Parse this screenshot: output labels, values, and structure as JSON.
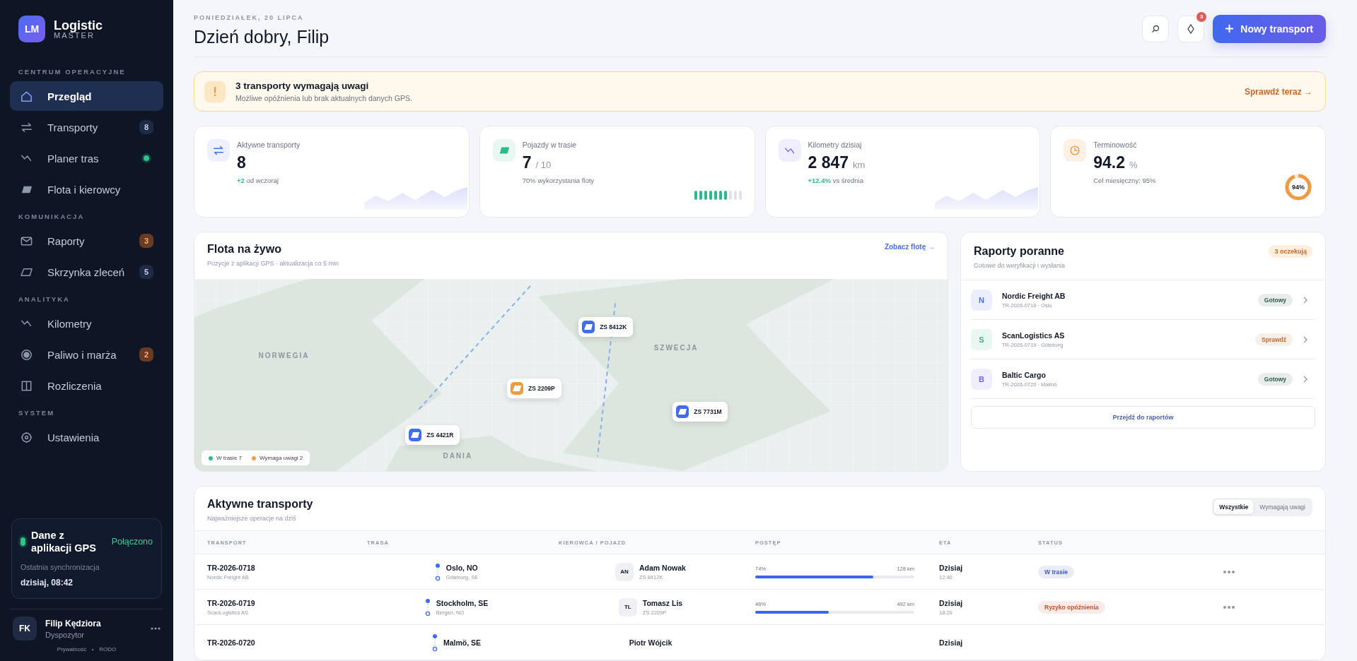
{
  "brand": {
    "initials": "LM",
    "name": "Logistic",
    "sub": "MASTER"
  },
  "sidebar": {
    "sections": [
      {
        "title": "CENTRUM OPERACYJNE",
        "items": [
          {
            "label": "Przegląd",
            "selected": true
          },
          {
            "label": "Transporty",
            "selected": false,
            "badge": {
              "text": "8",
              "color": "#1f2a44"
            }
          },
          {
            "label": "Planer tras",
            "selected": false,
            "color": "#2fc48d"
          },
          {
            "label": "Flota i kierowcy",
            "selected": false
          }
        ]
      },
      {
        "title": "KOMUNIKACJA",
        "items": [
          {
            "label": "Raporty",
            "selected": false,
            "badge": {
              "text": "3",
              "color": "#6b3a22"
            }
          },
          {
            "label": "Skrzynka zleceń",
            "selected": false,
            "badge": {
              "text": "5",
              "color": "#1f2a44"
            }
          }
        ]
      },
      {
        "title": "ANALITYKA",
        "items": [
          {
            "label": "Kilometry",
            "selected": false
          },
          {
            "label": "Paliwo i marża",
            "selected": false,
            "badge": {
              "text": "2",
              "color": "#6b3a22"
            }
          },
          {
            "label": "Rozliczenia",
            "selected": false
          }
        ]
      },
      {
        "title": "SYSTEM",
        "items": [
          {
            "label": "Ustawienia",
            "selected": false
          }
        ]
      }
    ]
  },
  "sync": {
    "title": "Dane z aplikacji GPS",
    "status": "Połączono",
    "connected": true,
    "label": "Ostatnia synchronizacja",
    "time": "dzisiaj, 08:42"
  },
  "user": {
    "initials": "FK",
    "name": "Filip Kędziora",
    "role": "Dyspozytor",
    "links": [
      "Prywatność",
      "RODO"
    ]
  },
  "header": {
    "date": "PONIEDZIAŁEK, 20 LIPCA",
    "greeting": "Dzień dobry, Filip",
    "notifications": "3",
    "primary_button": "Nowy transport"
  },
  "alert": {
    "title": "3 transporty wymagają uwagi",
    "text": "Możliwe opóźnienia lub brak aktualnych danych GPS.",
    "link": "Sprawdź teraz →"
  },
  "kpis": [
    {
      "label": "Aktywne transporty",
      "value": "8",
      "note": "**+2** od wczoraj"
    },
    {
      "label": "Pojazdy w trasie",
      "value": "7",
      "unit": "/ 10",
      "note": "70% wykorzystania floty",
      "level": 0.7
    },
    {
      "label": "Kilometry dzisiaj",
      "value": "2 847",
      "unit": "km",
      "note": "**+12.4%** vs średnia"
    },
    {
      "label": "Terminowość",
      "value": "94.2",
      "unit": "%",
      "note": "Cel miesięczny: 95%",
      "level": 0.94,
      "reading": "94%"
    }
  ],
  "map": {
    "title": "Flota na żywo",
    "subtitle": "Pozycje z aplikacji GPS · aktualizacja co 5 min",
    "link": "Zobacz flotę →",
    "regions": [
      "NORWEGIA",
      "SZWECJA",
      "DANIA"
    ],
    "vehicles": [
      {
        "plate": "ZS 8412K",
        "color": "#3f6cf0"
      },
      {
        "plate": "ZS 2209P",
        "color": "#ef9a45"
      },
      {
        "plate": "ZS 7731M",
        "color": "#3f6cf0"
      },
      {
        "plate": "ZS 4421R",
        "color": "#3f6cf0"
      }
    ],
    "legend": [
      {
        "label": "W trasie 7",
        "color": "#2fb88a"
      },
      {
        "label": "Wymaga uwagi 2",
        "color": "#f0a04b"
      }
    ]
  },
  "reports": {
    "title": "Raporty poranne",
    "subtitle": "Gotowe do weryfikacji i wysłania",
    "badge": "3 oczekują",
    "items": [
      {
        "initial": "N",
        "name": "Nordic Freight AB",
        "meta": "TR-2026-0718 · Oslo",
        "color": "#4b6cf0",
        "status": {
          "text": "Gotowy",
          "color": "#2a5a53"
        }
      },
      {
        "initial": "S",
        "name": "ScanLogistics AS",
        "meta": "TR-2026-0719 · Göteborg",
        "color": "#2fb88a",
        "status": {
          "text": "Sprawdź",
          "color": "#c36a2a"
        }
      },
      {
        "initial": "B",
        "name": "Baltic Cargo",
        "meta": "TR-2026-0720 · Malmö",
        "color": "#7463e8",
        "status": {
          "text": "Gotowy",
          "color": "#2a5a53"
        }
      }
    ],
    "button": "Przejdź do raportów"
  },
  "table": {
    "title": "Aktywne transporty",
    "subtitle": "Najważniejsze operacje na dziś",
    "filters": [
      {
        "label": "Wszystkie",
        "selected": true
      },
      {
        "label": "Wymagają uwagi",
        "selected": false
      }
    ],
    "columns": [
      "TRANSPORT",
      "TRASA",
      "KIEROWCA / POJAZD",
      "POSTĘP",
      "ETA",
      "STATUS"
    ],
    "rows": [
      {
        "id": "TR-2026-0718",
        "client": "Nordic Freight AB",
        "from": "Oslo, NO",
        "to": "Göteborg, SE",
        "driver_initials": "AN",
        "driver": "Adam Nowak",
        "vehicle": "ZS 8412K",
        "progress": "74%",
        "level": 0.74,
        "distance": "128 km",
        "eta_day": "Dzisiaj",
        "eta_time": "12:40",
        "status": {
          "text": "W trasie",
          "color": "#3f57c8"
        }
      },
      {
        "id": "TR-2026-0719",
        "client": "ScanLogistics AS",
        "from": "Stockholm, SE",
        "to": "Bergen, NO",
        "driver_initials": "TL",
        "driver": "Tomasz Lis",
        "vehicle": "ZS 2209P",
        "progress": "46%",
        "level": 0.46,
        "distance": "492 km",
        "eta_day": "Dzisiaj",
        "eta_time": "18:20",
        "status": {
          "text": "Ryzyko opóźnienia",
          "color": "#c8502c"
        }
      },
      {
        "id": "TR-2026-0720",
        "from": "Malmö, SE",
        "driver": "Piotr Wójcik",
        "eta_day": "Dzisiaj"
      }
    ]
  }
}
